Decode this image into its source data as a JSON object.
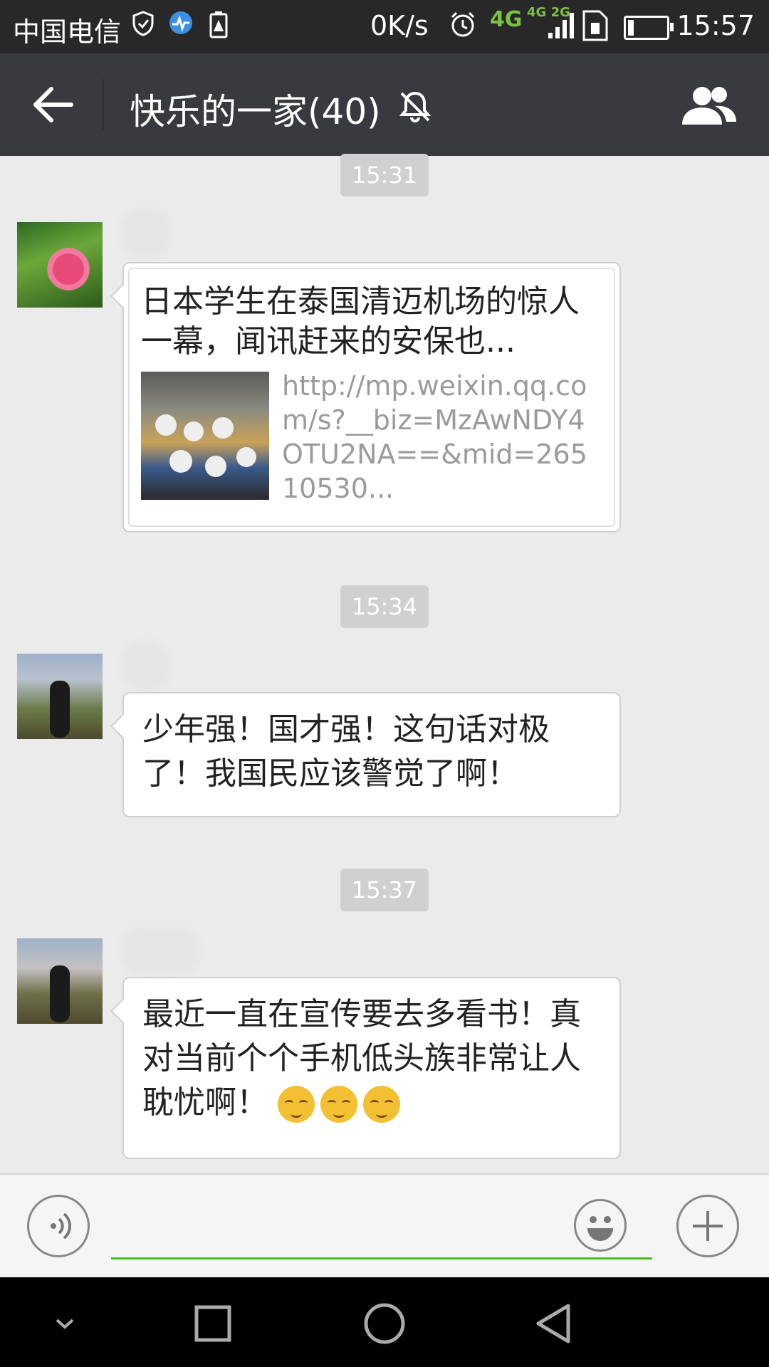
{
  "status_bar": {
    "carrier": "中国电信",
    "net_speed": "0K/s",
    "network_4g": "4G",
    "network_4g_2g": "4G 2G",
    "time": "15:57",
    "battery_level": 0.15
  },
  "title_bar": {
    "title": "快乐的一家(40)"
  },
  "chat": {
    "messages": [
      {
        "time": "15:31",
        "type": "link",
        "title": "日本学生在泰国清迈机场的惊人一幕，闻讯赶来的安保也...",
        "url": "http://mp.weixin.qq.com/s?__biz=MzAwNDY4OTU2NA==&mid=26510530..."
      },
      {
        "time": "15:34",
        "type": "text",
        "text": "少年强！国才强！这句话对极了！我国民应该警觉了啊！"
      },
      {
        "time": "15:37",
        "type": "text",
        "text": "最近一直在宣传要去多看书！真对当前个个手机低头族非常让人耽忧啊！"
      }
    ]
  },
  "input_bar": {
    "value": ""
  },
  "colors": {
    "title_bar_bg": "#393a3f",
    "status_bar_bg": "#282828",
    "chat_bg": "#ebebeb",
    "input_underline": "#45c01a",
    "network_green": "#7cc242"
  }
}
